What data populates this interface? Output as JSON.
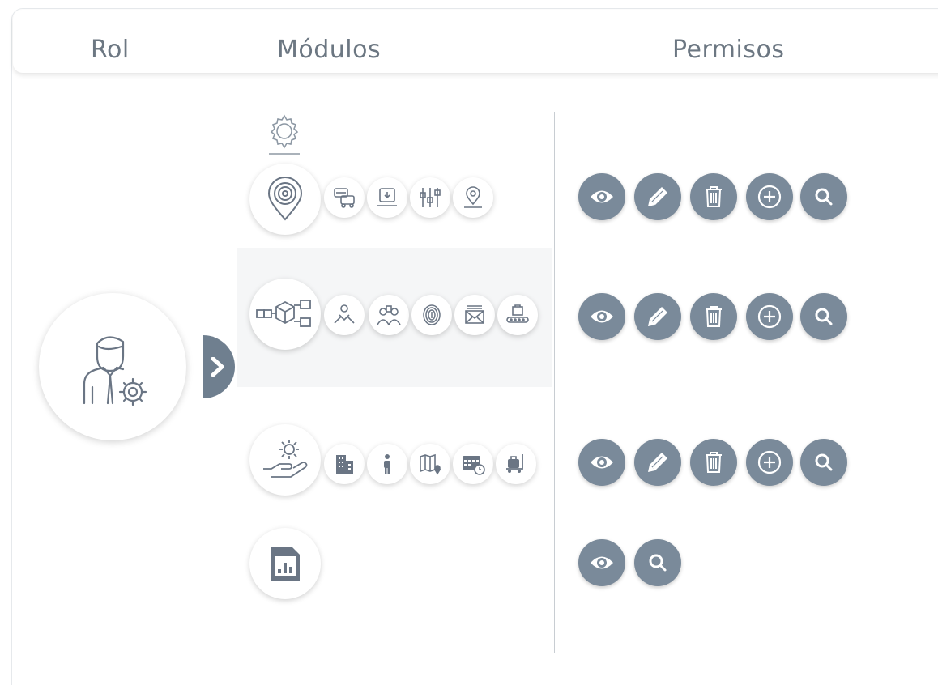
{
  "header": {
    "rol_label": "Rol",
    "modulos_label": "Módulos",
    "permisos_label": "Permisos"
  },
  "colors": {
    "accent": "#7a8a9a",
    "icon_stroke": "#6a7584",
    "band": "#f5f6f7",
    "divider": "#c8cdd2"
  },
  "role": {
    "icon": "user-gear-icon"
  },
  "modules": [
    {
      "icon": "location-pin-icon",
      "submodules": [
        "vehicles-icon",
        "monitor-icon",
        "sliders-icon",
        "map-pin-icon"
      ],
      "permissions": [
        "view",
        "edit",
        "delete",
        "add",
        "search"
      ]
    },
    {
      "icon": "package-flow-icon",
      "submodules": [
        "handshake-icon",
        "group-icon",
        "fingerprint-icon",
        "mail-icon",
        "conveyor-icon"
      ],
      "permissions": [
        "view",
        "edit",
        "delete",
        "add",
        "search"
      ]
    },
    {
      "icon": "hand-gear-icon",
      "submodules": [
        "building-icon",
        "person-icon",
        "map-icon",
        "calendar-clock-icon",
        "luggage-cart-icon"
      ],
      "permissions": [
        "view",
        "edit",
        "delete",
        "add",
        "search"
      ]
    },
    {
      "icon": "report-icon",
      "submodules": [],
      "permissions": [
        "view",
        "search"
      ]
    }
  ]
}
